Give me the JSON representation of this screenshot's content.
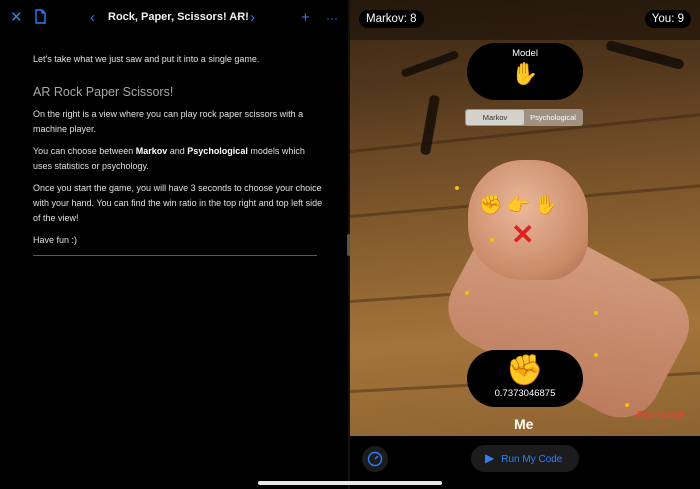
{
  "toolbar": {
    "close_icon": "xmark-icon",
    "doc_icon": "document-icon",
    "title": "Rock, Paper, Scissors! AR!",
    "prev_icon": "chevron-left-icon",
    "next_icon": "chevron-right-icon",
    "add_icon": "plus-icon",
    "more_icon": "ellipsis-icon",
    "accent": "#2f7ff5"
  },
  "article": {
    "intro": "Let's take what we just saw and put it into a single game.",
    "heading": "AR Rock Paper Scissors!",
    "p1": "On the right is a view where you can play rock paper scissors with a machine player.",
    "p2_a": "You can choose between ",
    "p2_b": "Markov",
    "p2_c": " and ",
    "p2_d": "Psychological",
    "p2_e": " models which uses statistics or psychology.",
    "p3": "Once you start the game, you will have 3 seconds to choose your choice with your hand. You can find the win ratio in the top right and top left side of the view!",
    "p4": "Have fun :)"
  },
  "ar": {
    "score_left": "Markov: 8",
    "score_right": "You: 9",
    "model_label": "Model",
    "model_choice_emoji": "✋",
    "segment": [
      "Markov",
      "Psychological"
    ],
    "segment_selected": "Markov",
    "choices": "✊👉✋",
    "result_mark": "✕",
    "me_emoji": "✊",
    "me_value": "0.7373046875",
    "me_label": "Me",
    "end_game": "End Game"
  },
  "bottom": {
    "gauge_icon": "speedometer-icon",
    "run_label": "Run My Code",
    "run_icon": "play-icon"
  }
}
